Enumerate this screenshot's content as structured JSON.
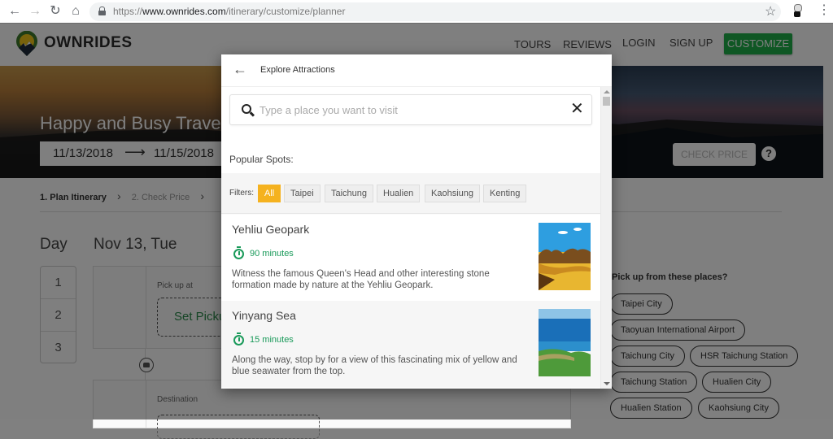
{
  "browser": {
    "url_prefix": "https://",
    "url_host": "www.ownrides.com",
    "url_path": "/itinerary/customize/planner",
    "icons": [
      "back-icon",
      "forward-icon",
      "reload-icon",
      "home-icon",
      "lock-icon",
      "star-icon",
      "extension-icon",
      "menu-icon"
    ]
  },
  "header": {
    "brand": "OWNRIDES",
    "nav": [
      "TOURS",
      "REVIEWS",
      "LOGIN",
      "SIGN UP"
    ],
    "cta": "CUSTOMIZE",
    "accent_color": "#1fae48"
  },
  "hero": {
    "title": "Happy and Busy Travel",
    "start_date": "11/13/2018",
    "arrow": "⟶",
    "end_date": "11/15/2018",
    "check_price": "CHECK PRICE",
    "help": "?"
  },
  "steps": {
    "step1": "1. Plan Itinerary",
    "step2": "2. Check Price",
    "separator": "›"
  },
  "planner": {
    "day_label": "Day",
    "date": "Nov 13, Tue",
    "days": [
      "1",
      "2",
      "3"
    ],
    "pickup_label": "Pick up at",
    "pickup_button": "Set Pickup",
    "destination_label": "Destination"
  },
  "pickup_suggestions": {
    "question": "Pick up from these places?",
    "places": [
      "Taipei City",
      "Taoyuan International Airport",
      "Taichung City",
      "HSR Taichung Station",
      "Taichung Station",
      "Hualien City",
      "Hualien Station",
      "Kaohsiung City"
    ]
  },
  "modal": {
    "title": "Explore Attractions",
    "back_icon": "←",
    "search_placeholder": "Type a place you want to visit",
    "search_value": "",
    "clear_icon": "✕",
    "popular_label": "Popular Spots:",
    "filters_label": "Filters:",
    "filters": [
      {
        "label": "All",
        "active": true
      },
      {
        "label": "Taipei",
        "active": false
      },
      {
        "label": "Taichung",
        "active": false
      },
      {
        "label": "Hualien",
        "active": false
      },
      {
        "label": "Kaohsiung",
        "active": false
      },
      {
        "label": "Kenting",
        "active": false
      }
    ],
    "filter_active_color": "#f5b21f",
    "spots": [
      {
        "name": "Yehliu Geopark",
        "duration": "90 minutes",
        "description": "Witness the famous Queen's Head and other interesting stone formation made by nature at the Yehliu Geopark."
      },
      {
        "name": "Yinyang Sea",
        "duration": "15 minutes",
        "description": "Along the way, stop by for a view of this fascinating mix of yellow and blue seawater from the top."
      }
    ],
    "duration_color": "#1a9a5a"
  }
}
